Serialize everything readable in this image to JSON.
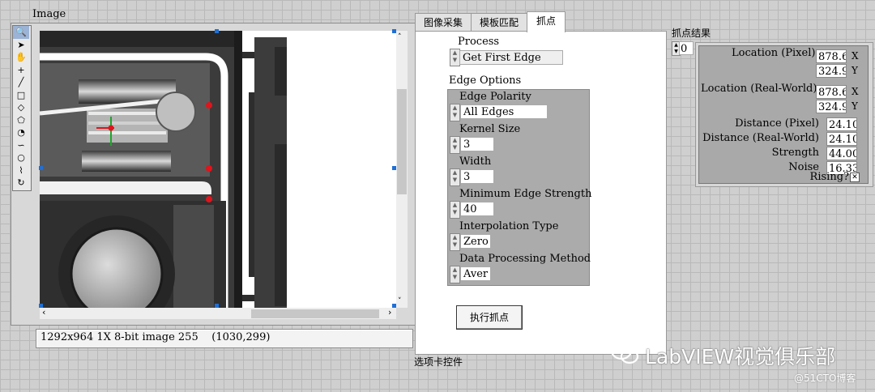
{
  "image_display": {
    "label": "Image",
    "status": "1292x964 1X 8-bit image 255    (1030,299)"
  },
  "tabs": {
    "items": [
      "图像采集",
      "模板匹配",
      "抓点"
    ],
    "active": "抓点",
    "caption": "选项卡控件"
  },
  "process": {
    "label": "Process",
    "value": "Get First Edge"
  },
  "edge_options": {
    "label": "Edge Options",
    "polarity_label": "Edge Polarity",
    "polarity_value": "All Edges",
    "kernel_label": "Kernel Size",
    "kernel_value": "3",
    "width_label": "Width",
    "width_value": "3",
    "min_strength_label": "Minimum Edge Strength",
    "min_strength_value": "40",
    "interp_label": "Interpolation Type",
    "interp_value": "Zero",
    "dpm_label": "Data Processing Method",
    "dpm_value": "Aver"
  },
  "execute_button": "执行抓点",
  "results": {
    "label": "抓点结果",
    "index": "0",
    "loc_pixel_label": "Location (Pixel)",
    "loc_pixel_x": "878.60",
    "loc_pixel_y": "324.90",
    "loc_world_label": "Location (Real-World)",
    "loc_world_x": "878.60",
    "loc_world_y": "324.90",
    "x_label": "X",
    "y_label": "Y",
    "dist_pixel_label": "Distance (Pixel)",
    "dist_pixel_value": "24.10",
    "dist_world_label": "Distance (Real-World)",
    "dist_world_value": "24.10",
    "strength_label": "Strength",
    "strength_value": "44.00",
    "noise_label": "Noise",
    "noise_value": "16.33",
    "rising_label": "Rising?"
  },
  "watermark": {
    "brand": "LabVIEW视觉俱乐部",
    "site": "@51CTO博客"
  },
  "colors": {
    "selection_handle": "#1f6fd6",
    "edge_point": "#e0141c",
    "cursor_cross_red": "#e0141c",
    "cursor_cross_green": "#1ea62a"
  },
  "icons": [
    "zoom-icon",
    "arrow-icon",
    "pan-hand-icon",
    "crosshair-icon",
    "line-icon",
    "rectangle-icon",
    "rotated-rectangle-icon",
    "polygon-icon",
    "annulus-icon",
    "freehand-icon",
    "oval-icon",
    "broken-line-icon",
    "rotate-icon"
  ]
}
